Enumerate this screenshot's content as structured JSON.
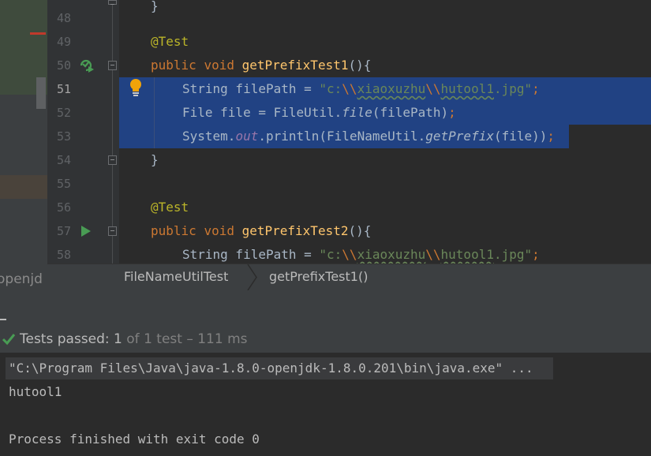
{
  "left_panel": {
    "tree_fragment": "openjd"
  },
  "editor": {
    "line_numbers": [
      "48",
      "49",
      "50",
      "51",
      "52",
      "53",
      "54",
      "55",
      "56",
      "57",
      "58"
    ],
    "code": {
      "l49": {
        "annotation": "@Test"
      },
      "l50": {
        "kw1": "public",
        "kw2": "void",
        "method": "getPrefixTest1",
        "tail": "(){"
      },
      "l51": {
        "type": "String filePath = ",
        "q1": "\"c:",
        "e1": "\\\\",
        "w1": "xiaoxuzhu",
        "e2": "\\\\",
        "w2": "hutool1",
        "q2": ".jpg\"",
        "semi": ";"
      },
      "l52": {
        "a": "File file = FileUtil.",
        "m": "file",
        "b": "(filePath)",
        "semi": ";"
      },
      "l53": {
        "a": "System.",
        "f": "out",
        "b": ".println(FileNameUtil.",
        "m": "getPrefix",
        "c": "(file))",
        "semi": ";"
      },
      "l54": {
        "brace": "}"
      },
      "l56": {
        "annotation": "@Test"
      },
      "l57": {
        "kw1": "public",
        "kw2": "void",
        "method": "getPrefixTest2",
        "tail": "(){"
      },
      "l58": {
        "type": "String filePath = ",
        "q1": "\"c:",
        "e1": "\\\\",
        "w1": "xiaoxuzhu",
        "e2": "\\\\",
        "w2": "hutool1",
        "q2": ".jpg\"",
        "semi": ";"
      }
    }
  },
  "breadcrumb": {
    "items": [
      "FileNameUtilTest",
      "getPrefixTest1()"
    ]
  },
  "test_status": {
    "label": "Tests passed: ",
    "passed": "1",
    "rest": " of 1 test – 111 ms"
  },
  "console": {
    "lines": [
      "\"C:\\Program Files\\Java\\java-1.8.0-openjdk-1.8.0.201\\bin\\java.exe\" ...",
      "hutool1",
      "",
      "Process finished with exit code 0"
    ]
  },
  "colors": {
    "editor_bg": "#2b2b2b",
    "selection": "#214283",
    "keyword": "#cc7832",
    "string": "#6a8759",
    "method": "#ffc66d",
    "annotation": "#bbb529",
    "success": "#499c54"
  },
  "icons": [
    "run-test-passed-icon",
    "run-icon",
    "lightbulb-icon",
    "fold-icon",
    "check-icon"
  ]
}
